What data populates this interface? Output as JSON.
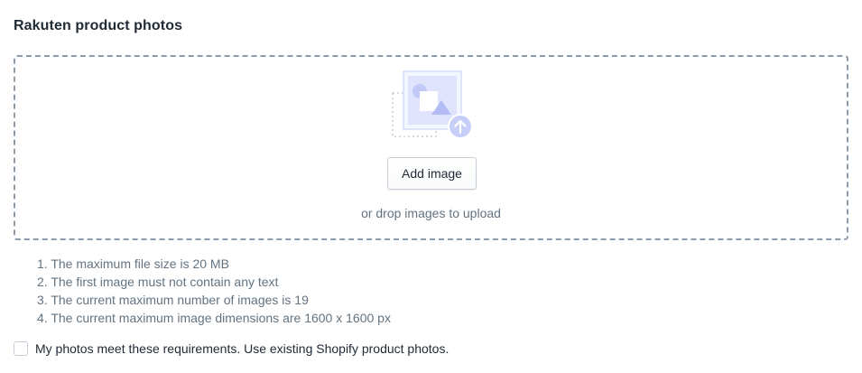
{
  "section": {
    "title": "Rakuten product photos"
  },
  "dropzone": {
    "button_label": "Add image",
    "hint": "or drop images to upload",
    "illustration_icon": "image-upload-icon"
  },
  "requirements": [
    "1. The maximum file size is 20 MB",
    "2. The first image must not contain any text",
    "3. The current maximum number of images is 19",
    "4. The current maximum image dimensions are 1600 x 1600 px"
  ],
  "confirm": {
    "label": "My photos meet these requirements. Use existing Shopify product photos.",
    "checked": false
  },
  "colors": {
    "dropzone_border": "#8c9bab",
    "illustration_accent": "#b3bcf5",
    "muted_text": "#637381",
    "primary_text": "#212b36"
  }
}
